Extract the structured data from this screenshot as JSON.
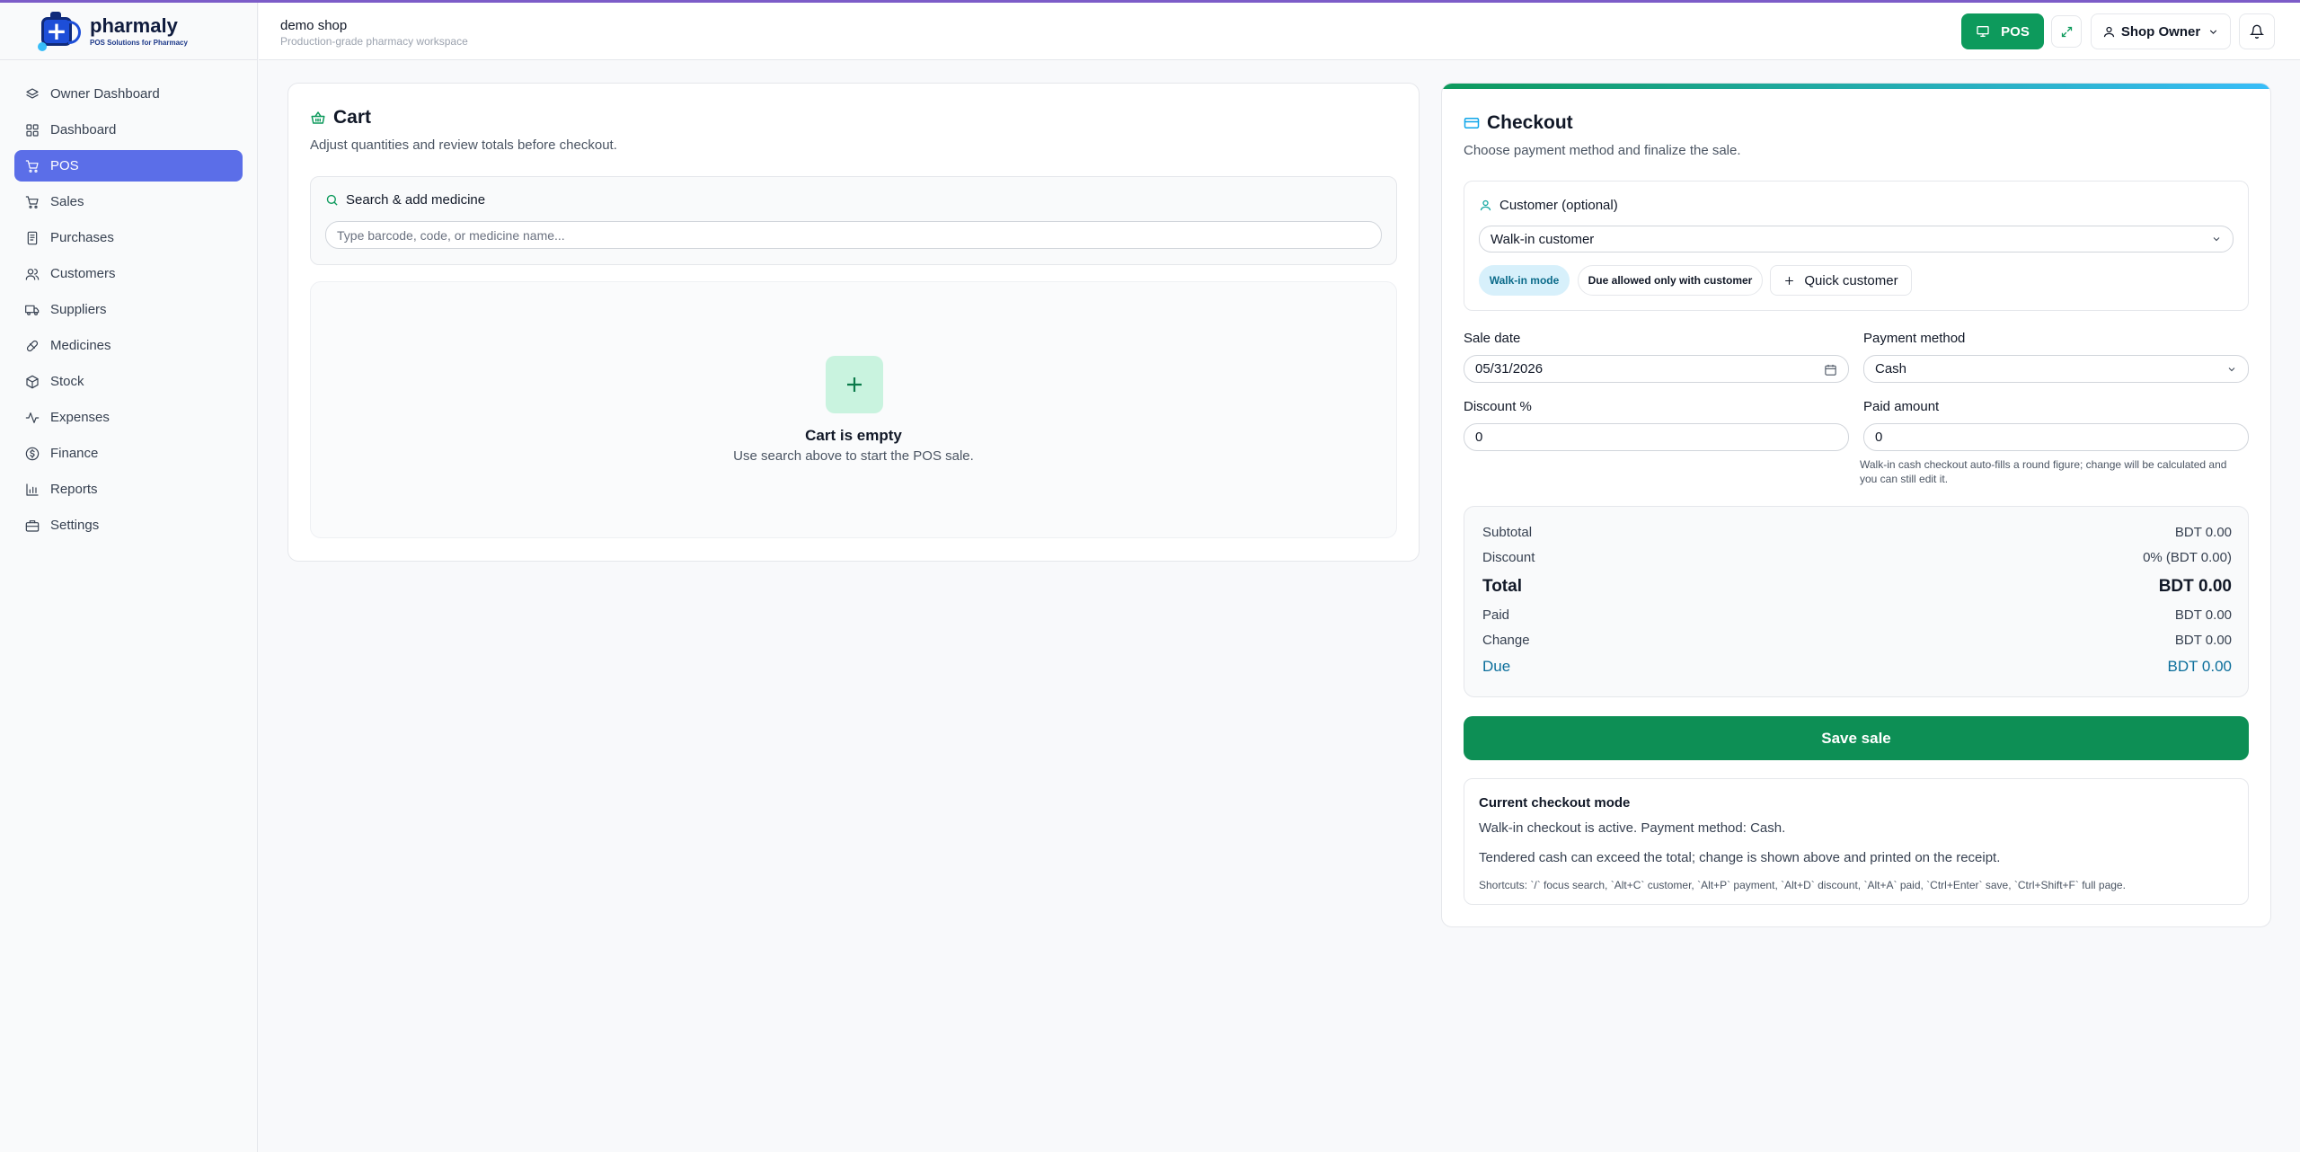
{
  "brand": {
    "name": "pharmaly",
    "tagline": "POS Solutions for Pharmacy"
  },
  "sidebar": {
    "items": [
      {
        "label": "Owner Dashboard",
        "icon": "layers-icon"
      },
      {
        "label": "Dashboard",
        "icon": "grid-icon"
      },
      {
        "label": "POS",
        "icon": "cart-icon",
        "active": true
      },
      {
        "label": "Sales",
        "icon": "cart-icon"
      },
      {
        "label": "Purchases",
        "icon": "receipt-icon"
      },
      {
        "label": "Customers",
        "icon": "users-icon"
      },
      {
        "label": "Suppliers",
        "icon": "truck-icon"
      },
      {
        "label": "Medicines",
        "icon": "pill-icon"
      },
      {
        "label": "Stock",
        "icon": "box-icon"
      },
      {
        "label": "Expenses",
        "icon": "activity-icon"
      },
      {
        "label": "Finance",
        "icon": "dollar-icon"
      },
      {
        "label": "Reports",
        "icon": "bar-chart-icon"
      },
      {
        "label": "Settings",
        "icon": "briefcase-icon"
      }
    ]
  },
  "header": {
    "shop_name": "demo shop",
    "shop_subtitle": "Production-grade pharmacy workspace",
    "pos_button": "POS",
    "user_label": "Shop Owner"
  },
  "cart": {
    "title": "Cart",
    "subtitle": "Adjust quantities and review totals before checkout.",
    "search_label": "Search & add medicine",
    "search_placeholder": "Type barcode, code, or medicine name...",
    "empty_title": "Cart is empty",
    "empty_subtitle": "Use search above to start the POS sale."
  },
  "checkout": {
    "title": "Checkout",
    "subtitle": "Choose payment method and finalize the sale.",
    "customer_label": "Customer (optional)",
    "customer_value": "Walk-in customer",
    "chip_walkin": "Walk-in mode",
    "chip_due": "Due allowed only with customer",
    "quick_customer": "Quick customer",
    "sale_date_label": "Sale date",
    "sale_date_value": "05/31/2026",
    "payment_method_label": "Payment method",
    "payment_method_value": "Cash",
    "discount_label": "Discount %",
    "discount_value": "0",
    "paid_amount_label": "Paid amount",
    "paid_amount_value": "0",
    "paid_hint": "Walk-in cash checkout auto-fills a round figure; change will be calculated and you can still edit it.",
    "totals": {
      "subtotal_label": "Subtotal",
      "subtotal_value": "BDT 0.00",
      "discount_label": "Discount",
      "discount_value": "0% (BDT 0.00)",
      "total_label": "Total",
      "total_value": "BDT 0.00",
      "paid_label": "Paid",
      "paid_value": "BDT 0.00",
      "change_label": "Change",
      "change_value": "BDT 0.00",
      "due_label": "Due",
      "due_value": "BDT 0.00"
    },
    "save_button": "Save sale",
    "mode": {
      "title": "Current checkout mode",
      "line1": "Walk-in checkout is active. Payment method: Cash.",
      "line2": "Tendered cash can exceed the total; change is shown above and printed on the receipt.",
      "shortcuts": "Shortcuts: `/` focus search, `Alt+C` customer, `Alt+P` payment, `Alt+D` discount, `Alt+A` paid, `Ctrl+Enter` save, `Ctrl+Shift+F` full page."
    }
  },
  "colors": {
    "accent": "#5b6ee8",
    "brand_green": "#0d9a5c",
    "due_blue": "#0b6e9b",
    "top_line": "#7c5cc8"
  }
}
